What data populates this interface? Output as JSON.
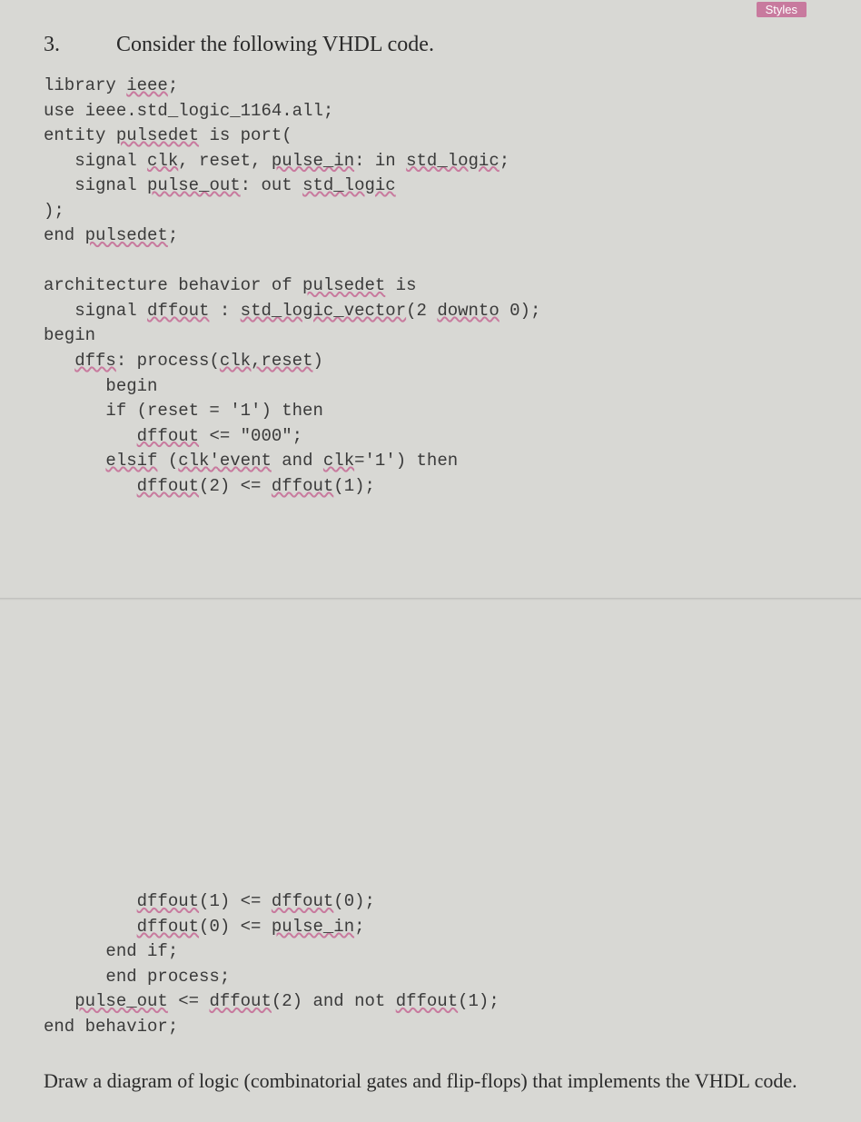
{
  "tab": {
    "label": "Styles"
  },
  "question": {
    "number": "3.",
    "prompt": "Consider the following VHDL code."
  },
  "code": {
    "line01_a": "library ",
    "line01_b": "ieee",
    "line01_c": ";",
    "line02": "use ieee.std_logic_1164.all;",
    "line03_a": "entity ",
    "line03_b": "pulsedet",
    "line03_c": " is port(",
    "line04_a": "   signal ",
    "line04_b": "clk",
    "line04_c": ", reset, ",
    "line04_d": "pulse_in",
    "line04_e": ": in ",
    "line04_f": "std_logic",
    "line04_g": ";",
    "line05_a": "   signal ",
    "line05_b": "pulse_out",
    "line05_c": ": out ",
    "line05_d": "std_logic",
    "line06": ");",
    "line07_a": "end ",
    "line07_b": "pulsedet",
    "line07_c": ";",
    "line08": "",
    "line09_a": "architecture behavior of ",
    "line09_b": "pulsedet",
    "line09_c": " is",
    "line10_a": "   signal ",
    "line10_b": "dffout",
    "line10_c": " : ",
    "line10_d": "std_logic_vector",
    "line10_e": "(2 ",
    "line10_f": "downto",
    "line10_g": " 0);",
    "line11": "begin",
    "line12_a": "   ",
    "line12_b": "dffs",
    "line12_c": ": process(",
    "line12_d": "clk,reset",
    "line12_e": ")",
    "line13": "      begin",
    "line14": "      if (reset = '1') then",
    "line15_a": "         ",
    "line15_b": "dffout",
    "line15_c": " <= \"000\";",
    "line16_a": "      ",
    "line16_b": "elsif",
    "line16_c": " (",
    "line16_d": "clk'event",
    "line16_e": " and ",
    "line16_f": "clk",
    "line16_g": "='1') then",
    "line17_a": "         ",
    "line17_b": "dffout",
    "line17_c": "(2) <= ",
    "line17_d": "dffout",
    "line17_e": "(1);",
    "line18_a": "         ",
    "line18_b": "dffout",
    "line18_c": "(1) <= ",
    "line18_d": "dffout",
    "line18_e": "(0);",
    "line19_a": "         ",
    "line19_b": "dffout",
    "line19_c": "(0) <= ",
    "line19_d": "pulse_in",
    "line19_e": ";",
    "line20": "      end if;",
    "line21": "      end process;",
    "line22_a": "   ",
    "line22_b": "pulse_out",
    "line22_c": " <= ",
    "line22_d": "dffout",
    "line22_e": "(2) and not ",
    "line22_f": "dffout",
    "line22_g": "(1);",
    "line23": "end behavior;"
  },
  "instruction": {
    "text": "Draw a diagram of logic (combinatorial gates and flip-flops) that implements the VHDL code."
  }
}
